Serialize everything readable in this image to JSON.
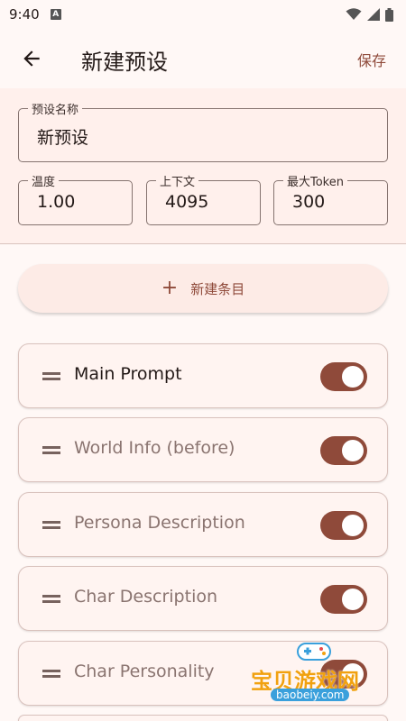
{
  "status_bar": {
    "time": "9:40",
    "notif_glyph": "A"
  },
  "app_bar": {
    "title": "新建预设",
    "save_label": "保存"
  },
  "preset": {
    "name_label": "预设名称",
    "name_value": "新预设",
    "temperature_label": "温度",
    "temperature_value": "1.00",
    "context_label": "上下文",
    "context_value": "4095",
    "max_token_label": "最大Token",
    "max_token_value": "300"
  },
  "add_item": {
    "icon": "+",
    "label": "新建条目"
  },
  "entries": [
    {
      "label": "Main Prompt",
      "enabled": true,
      "style": "on"
    },
    {
      "label": "World Info (before)",
      "enabled": true,
      "style": "dim"
    },
    {
      "label": "Persona Description",
      "enabled": true,
      "style": "dim"
    },
    {
      "label": "Char Description",
      "enabled": true,
      "style": "dim"
    },
    {
      "label": "Char Personality",
      "enabled": true,
      "style": "dim"
    }
  ],
  "watermark": {
    "text": "宝贝游戏网",
    "url": "baobeiy.com"
  },
  "colors": {
    "accent": "#8f4a3a",
    "surface": "#fff0ec",
    "background": "#fff8f6"
  }
}
